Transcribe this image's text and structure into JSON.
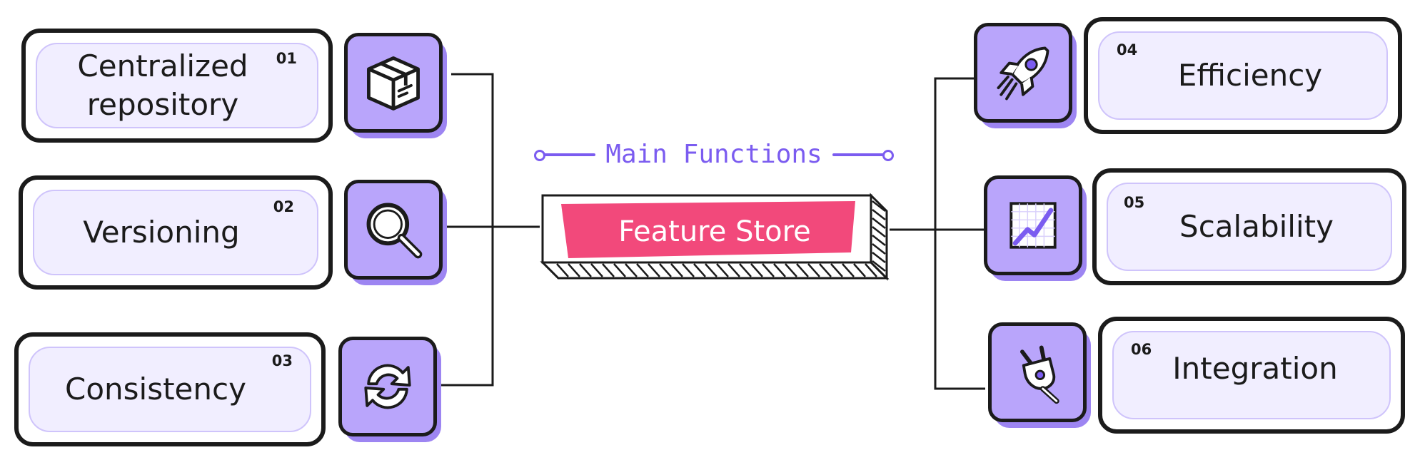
{
  "title": "Main Functions",
  "center": {
    "label": "Feature Store"
  },
  "colors": {
    "accent": "#7b5cf0",
    "tile_fill": "#b9a5fb",
    "tile_shadow": "#9d85f2",
    "card_inner": "#f1eeff",
    "banner": "#f2497b",
    "ink": "#1b1b1b"
  },
  "functions": [
    {
      "num": "01",
      "label": "Centralized\nrepository",
      "icon": "box-icon"
    },
    {
      "num": "02",
      "label": "Versioning",
      "icon": "magnifier-icon"
    },
    {
      "num": "03",
      "label": "Consistency",
      "icon": "refresh-icon"
    },
    {
      "num": "04",
      "label": "Efficiency",
      "icon": "rocket-icon"
    },
    {
      "num": "05",
      "label": "Scalability",
      "icon": "growth-chart-icon"
    },
    {
      "num": "06",
      "label": "Integration",
      "icon": "plug-icon"
    }
  ]
}
